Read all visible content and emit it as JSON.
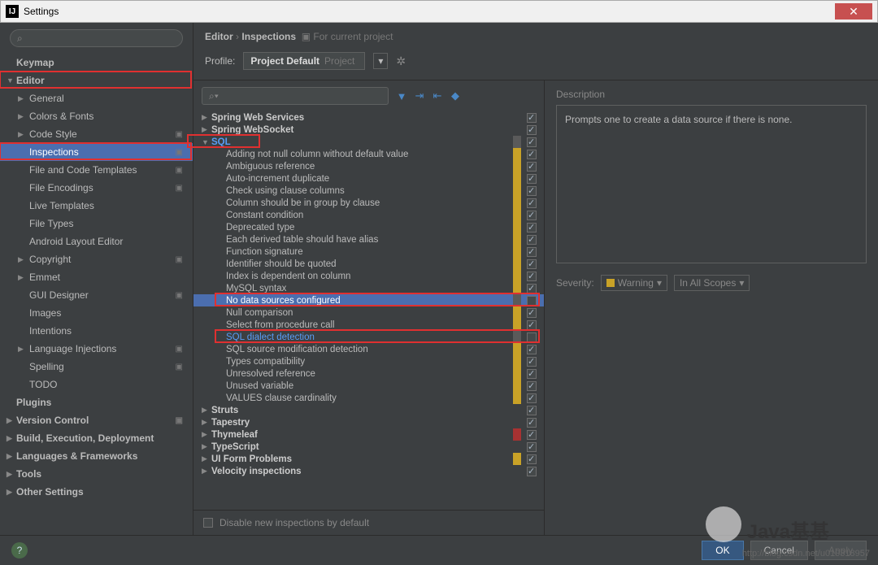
{
  "window": {
    "title": "Settings"
  },
  "breadcrumb": {
    "a": "Editor",
    "b": "Inspections",
    "scope": "For current project"
  },
  "profile": {
    "label": "Profile:",
    "name": "Project Default",
    "suffix": "Project"
  },
  "sidebar": {
    "items": [
      {
        "label": "Keymap",
        "level": 0,
        "arrow": ""
      },
      {
        "label": "Editor",
        "level": 0,
        "arrow": "▼",
        "rb": true
      },
      {
        "label": "General",
        "level": 1,
        "arrow": "▶"
      },
      {
        "label": "Colors & Fonts",
        "level": 1,
        "arrow": "▶"
      },
      {
        "label": "Code Style",
        "level": 1,
        "arrow": "▶",
        "proj": true
      },
      {
        "label": "Inspections",
        "level": 1,
        "arrow": "",
        "selected": true,
        "proj": true,
        "rb": true
      },
      {
        "label": "File and Code Templates",
        "level": 1,
        "arrow": "",
        "proj": true
      },
      {
        "label": "File Encodings",
        "level": 1,
        "arrow": "",
        "proj": true
      },
      {
        "label": "Live Templates",
        "level": 1,
        "arrow": ""
      },
      {
        "label": "File Types",
        "level": 1,
        "arrow": ""
      },
      {
        "label": "Android Layout Editor",
        "level": 1,
        "arrow": ""
      },
      {
        "label": "Copyright",
        "level": 1,
        "arrow": "▶",
        "proj": true
      },
      {
        "label": "Emmet",
        "level": 1,
        "arrow": "▶"
      },
      {
        "label": "GUI Designer",
        "level": 1,
        "arrow": "",
        "proj": true
      },
      {
        "label": "Images",
        "level": 1,
        "arrow": ""
      },
      {
        "label": "Intentions",
        "level": 1,
        "arrow": ""
      },
      {
        "label": "Language Injections",
        "level": 1,
        "arrow": "▶",
        "proj": true
      },
      {
        "label": "Spelling",
        "level": 1,
        "arrow": "",
        "proj": true
      },
      {
        "label": "TODO",
        "level": 1,
        "arrow": ""
      },
      {
        "label": "Plugins",
        "level": 0,
        "arrow": ""
      },
      {
        "label": "Version Control",
        "level": 0,
        "arrow": "▶",
        "proj": true
      },
      {
        "label": "Build, Execution, Deployment",
        "level": 0,
        "arrow": "▶"
      },
      {
        "label": "Languages & Frameworks",
        "level": 0,
        "arrow": "▶"
      },
      {
        "label": "Tools",
        "level": 0,
        "arrow": "▶"
      },
      {
        "label": "Other Settings",
        "level": 0,
        "arrow": "▶"
      }
    ]
  },
  "inspections": {
    "tree": [
      {
        "type": "cat",
        "label": "Spring Web Services",
        "arrow": "▶",
        "checked": true
      },
      {
        "type": "cat",
        "label": "Spring WebSocket",
        "arrow": "▶",
        "checked": true
      },
      {
        "type": "cat",
        "label": "SQL",
        "arrow": "▼",
        "checked": true,
        "link": true,
        "rb": true,
        "sev": "none"
      },
      {
        "type": "child",
        "label": "Adding not null column without default value",
        "checked": true,
        "sev": "warning"
      },
      {
        "type": "child",
        "label": "Ambiguous reference",
        "checked": true,
        "sev": "warning"
      },
      {
        "type": "child",
        "label": "Auto-increment duplicate",
        "checked": true,
        "sev": "warning"
      },
      {
        "type": "child",
        "label": "Check using clause columns",
        "checked": true,
        "sev": "warning"
      },
      {
        "type": "child",
        "label": "Column should be in group by clause",
        "checked": true,
        "sev": "warning"
      },
      {
        "type": "child",
        "label": "Constant condition",
        "checked": true,
        "sev": "warning"
      },
      {
        "type": "child",
        "label": "Deprecated type",
        "checked": true,
        "sev": "warning"
      },
      {
        "type": "child",
        "label": "Each derived table should have alias",
        "checked": true,
        "sev": "warning"
      },
      {
        "type": "child",
        "label": "Function signature",
        "checked": true,
        "sev": "warning"
      },
      {
        "type": "child",
        "label": "Identifier should be quoted",
        "checked": true,
        "sev": "warning"
      },
      {
        "type": "child",
        "label": "Index is dependent on column",
        "checked": true,
        "sev": "warning"
      },
      {
        "type": "child",
        "label": "MySQL syntax",
        "checked": true,
        "sev": "warning"
      },
      {
        "type": "child",
        "label": "No data sources configured",
        "checked": false,
        "selected": true,
        "sev": "none",
        "rb": true
      },
      {
        "type": "child",
        "label": "Null comparison",
        "checked": true,
        "sev": "warning"
      },
      {
        "type": "child",
        "label": "Select from procedure call",
        "checked": true,
        "sev": "warning"
      },
      {
        "type": "child",
        "label": "SQL dialect detection",
        "checked": false,
        "link": true,
        "sev": "none",
        "rb": true
      },
      {
        "type": "child",
        "label": "SQL source modification detection",
        "checked": true,
        "sev": "warning"
      },
      {
        "type": "child",
        "label": "Types compatibility",
        "checked": true,
        "sev": "warning"
      },
      {
        "type": "child",
        "label": "Unresolved reference",
        "checked": true,
        "sev": "warning"
      },
      {
        "type": "child",
        "label": "Unused variable",
        "checked": true,
        "sev": "warning"
      },
      {
        "type": "child",
        "label": "VALUES clause cardinality",
        "checked": true,
        "sev": "warning"
      },
      {
        "type": "cat",
        "label": "Struts",
        "arrow": "▶",
        "checked": true
      },
      {
        "type": "cat",
        "label": "Tapestry",
        "arrow": "▶",
        "checked": true
      },
      {
        "type": "cat",
        "label": "Thymeleaf",
        "arrow": "▶",
        "checked": true,
        "sev": "error"
      },
      {
        "type": "cat",
        "label": "TypeScript",
        "arrow": "▶",
        "checked": true
      },
      {
        "type": "cat",
        "label": "UI Form Problems",
        "arrow": "▶",
        "checked": true,
        "sev": "warning"
      },
      {
        "type": "cat",
        "label": "Velocity inspections",
        "arrow": "▶",
        "checked": true
      }
    ],
    "disable_label": "Disable new inspections by default"
  },
  "right": {
    "desc_label": "Description",
    "desc_text": "Prompts one to create a data source if there is none.",
    "severity_label": "Severity:",
    "severity_value": "Warning",
    "scope_value": "In All Scopes"
  },
  "footer": {
    "ok": "OK",
    "cancel": "Cancel",
    "apply": "Apply"
  },
  "watermark": "http://blog.csdn.net/u010318957",
  "logo": "Java基基"
}
